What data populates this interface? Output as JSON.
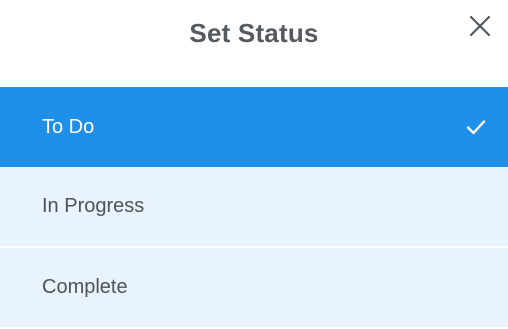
{
  "dialog": {
    "title": "Set Status",
    "close_icon": "close-icon"
  },
  "options": [
    {
      "label": "To Do",
      "selected": true,
      "icon": "checkmark-icon"
    },
    {
      "label": "In Progress",
      "selected": false
    },
    {
      "label": "Complete",
      "selected": false
    }
  ],
  "colors": {
    "selected_bg": "#1e90ea",
    "option_bg": "#e9f3fd",
    "title_text": "#555a5f",
    "option_text": "#4e5358"
  }
}
